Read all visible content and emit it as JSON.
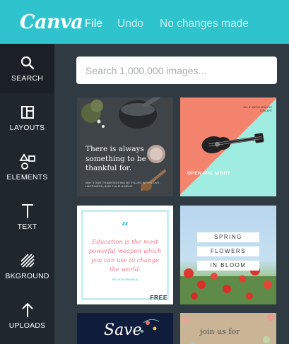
{
  "topbar": {
    "logo": "Canva",
    "menu": {
      "file": "File",
      "undo": "Undo",
      "status": "No changes made"
    },
    "bg_color": "#2fc4cd"
  },
  "sidebar": {
    "items": [
      {
        "label": "SEARCH",
        "icon": "search-icon",
        "active": true
      },
      {
        "label": "LAYOUTS",
        "icon": "layout-icon",
        "active": false
      },
      {
        "label": "ELEMENTS",
        "icon": "shapes-icon",
        "active": false
      },
      {
        "label": "TEXT",
        "icon": "text-icon",
        "active": false
      },
      {
        "label": "BKGROUND",
        "icon": "background-icon",
        "active": false
      },
      {
        "label": "UPLOADS",
        "icon": "upload-icon",
        "active": false
      }
    ]
  },
  "search": {
    "placeholder": "Search 1,000,000 images..."
  },
  "templates": [
    {
      "text": "There is always something to be thankful for.",
      "small": "MAY YOUR THANKSGIVING BE FILLED WITH LOVE, HAPPINESS, AND FULFILLMENT."
    },
    {
      "heading": "OPEN MIC NIGHT",
      "small": "MIX N' MATCH UKULELE CONCERT"
    },
    {
      "quote_mark": "“",
      "text": "Education is the most powerful weapon which you can use to change the world.",
      "small": "NELSON MANDELA",
      "badge": "FREE"
    },
    {
      "lines": [
        "SPRING",
        "FLOWERS",
        "IN BLOOM"
      ]
    },
    {
      "text": "Save"
    },
    {
      "text": "join us for"
    }
  ]
}
